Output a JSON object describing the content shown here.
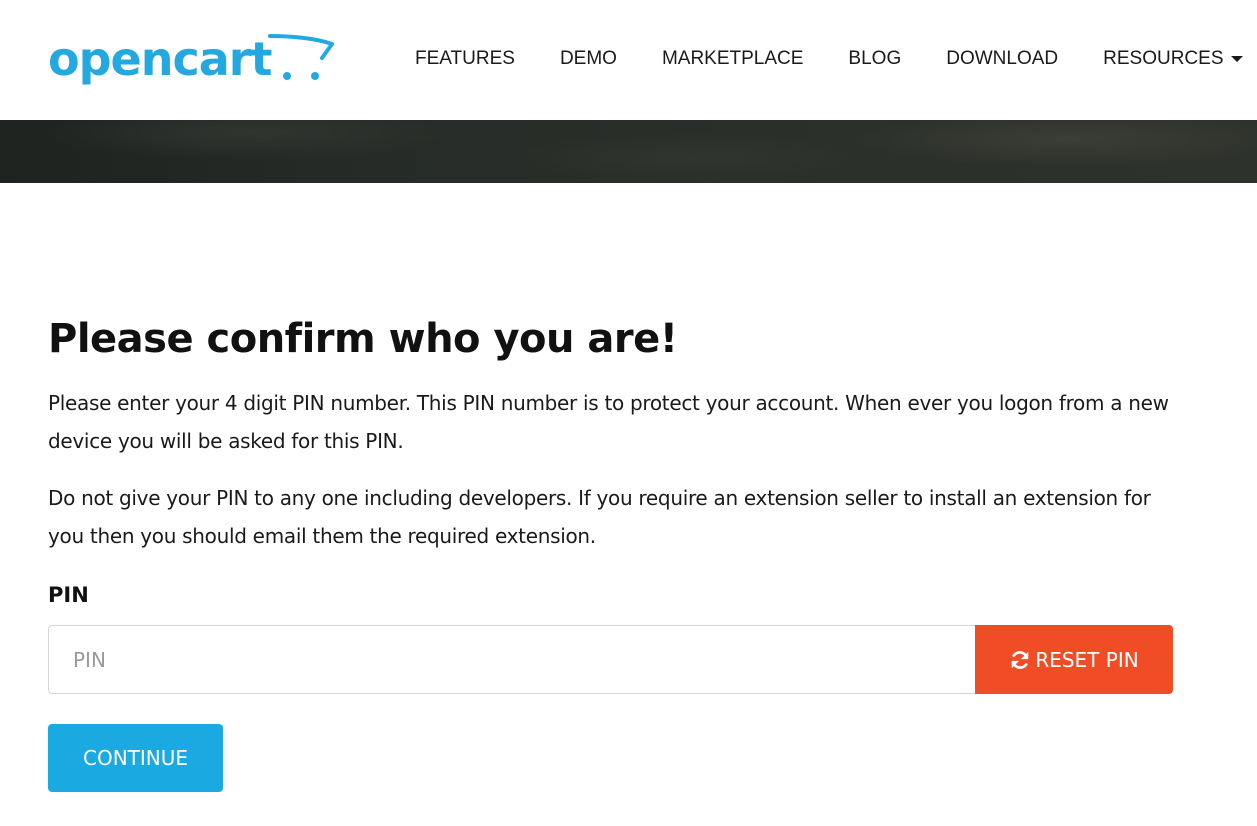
{
  "header": {
    "logo_text": "opencart",
    "brand_color": "#23a8e0",
    "nav": [
      {
        "label": "FEATURES"
      },
      {
        "label": "DEMO"
      },
      {
        "label": "MARKETPLACE"
      },
      {
        "label": "BLOG"
      },
      {
        "label": "DOWNLOAD"
      },
      {
        "label": "RESOURCES",
        "has_dropdown": true
      }
    ]
  },
  "main": {
    "title": "Please confirm who you are!",
    "paragraph_1": "Please enter your 4 digit PIN number. This PIN number is to protect your account. When ever you logon from a new device you will be asked for this PIN.",
    "paragraph_2": "Do not give your PIN to any one including developers. If you require an extension seller to install an extension for you then you should email them the required extension.",
    "pin_label": "PIN",
    "pin_input": {
      "value": "",
      "placeholder": "PIN"
    },
    "reset_button": {
      "label": "RESET PIN",
      "icon": "refresh-icon",
      "color": "#f04c25"
    },
    "continue_button": {
      "label": "CONTINUE",
      "color": "#1ba9e1"
    }
  }
}
